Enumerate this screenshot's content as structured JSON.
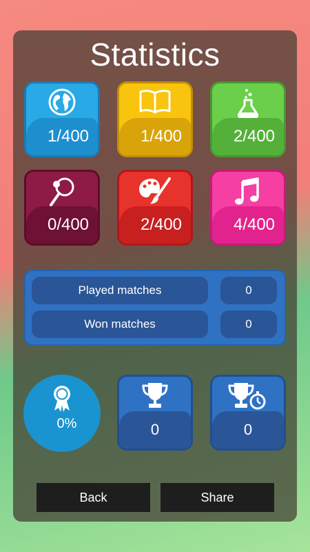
{
  "title": "Statistics",
  "categories": [
    {
      "name": "globe-icon",
      "count": "1/400",
      "color": "#29a9e6",
      "bar": "#1d8fcf",
      "border": "#1b7ab5"
    },
    {
      "name": "book-icon",
      "count": "1/400",
      "color": "#f8c40d",
      "bar": "#d9a40a",
      "border": "#c18f07"
    },
    {
      "name": "flask-icon",
      "count": "2/400",
      "color": "#6ccf4c",
      "bar": "#55b03a",
      "border": "#47992f"
    },
    {
      "name": "racket-icon",
      "count": "0/400",
      "color": "#8e1b44",
      "bar": "#6e1133",
      "border": "#5b0e2b"
    },
    {
      "name": "palette-icon",
      "count": "2/400",
      "color": "#e8322c",
      "bar": "#c81f1f",
      "border": "#b0181a"
    },
    {
      "name": "music-note-icon",
      "count": "4/400",
      "color": "#f53fa3",
      "bar": "#e3238d",
      "border": "#c9187a"
    }
  ],
  "matches": {
    "played_label": "Played matches",
    "played_value": "0",
    "won_label": "Won matches",
    "won_value": "0"
  },
  "win_rate": "0%",
  "trophies": {
    "wins": "0",
    "timed_wins": "0"
  },
  "buttons": {
    "back": "Back",
    "share": "Share"
  }
}
